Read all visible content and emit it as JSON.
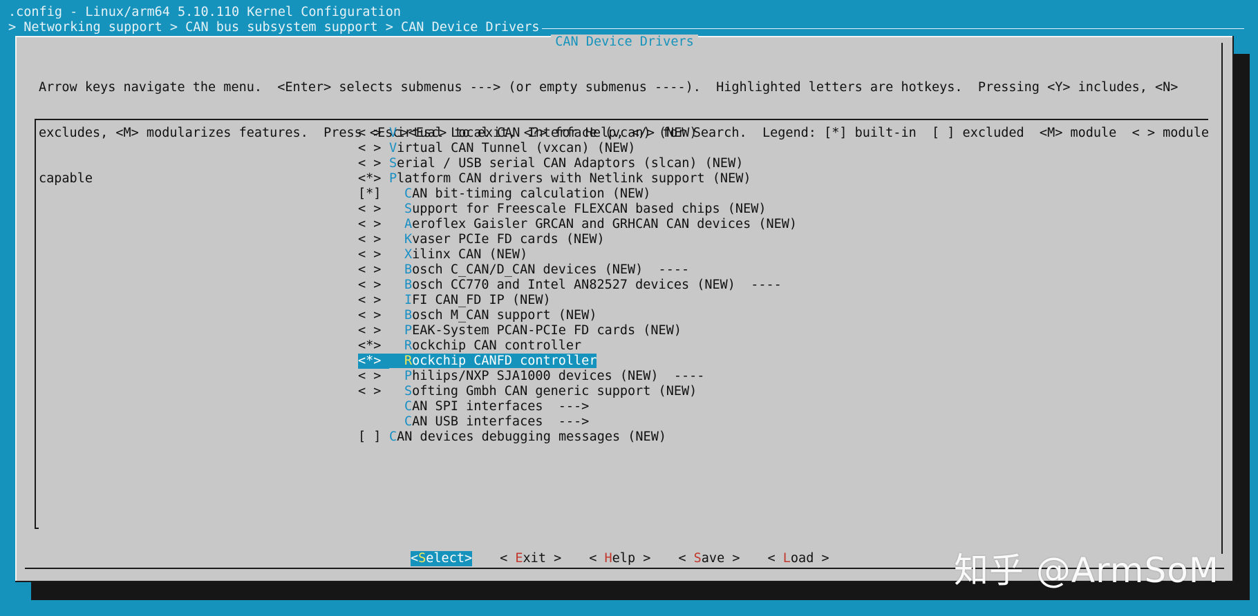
{
  "window_title": ".config - Linux/arm64 5.10.110 Kernel Configuration",
  "breadcrumb": "> Networking support > CAN bus subsystem support > CAN Device Drivers",
  "dialog_title": "CAN Device Drivers",
  "help": {
    "line1": "Arrow keys navigate the menu.  <Enter> selects submenus ---> (or empty submenus ----).  Highlighted letters are hotkeys.  Pressing <Y> includes, <N>",
    "line2": "excludes, <M> modularizes features.  Press <Esc><Esc> to exit, <?> for Help, </> for Search.  Legend: [*] built-in  [ ] excluded  <M> module  < > module",
    "line3": "capable"
  },
  "menu": [
    {
      "state": "< >",
      "indent": 0,
      "hot": "V",
      "rest": "irtual Local CAN Interface (vcan) (NEW)"
    },
    {
      "state": "< >",
      "indent": 0,
      "hot": "V",
      "rest": "irtual CAN Tunnel (vxcan) (NEW)"
    },
    {
      "state": "< >",
      "indent": 0,
      "hot": "S",
      "rest": "erial / USB serial CAN Adaptors (slcan) (NEW)"
    },
    {
      "state": "<*>",
      "indent": 0,
      "hot": "P",
      "rest": "latform CAN drivers with Netlink support (NEW)"
    },
    {
      "state": "[*]",
      "indent": 1,
      "hot": "C",
      "rest": "AN bit-timing calculation (NEW)"
    },
    {
      "state": "< >",
      "indent": 1,
      "hot": "S",
      "rest": "upport for Freescale FLEXCAN based chips (NEW)"
    },
    {
      "state": "< >",
      "indent": 1,
      "hot": "A",
      "rest": "eroflex Gaisler GRCAN and GRHCAN CAN devices (NEW)"
    },
    {
      "state": "< >",
      "indent": 1,
      "hot": "K",
      "rest": "vaser PCIe FD cards (NEW)"
    },
    {
      "state": "< >",
      "indent": 1,
      "hot": "X",
      "rest": "ilinx CAN (NEW)"
    },
    {
      "state": "< >",
      "indent": 1,
      "hot": "B",
      "rest": "osch C_CAN/D_CAN devices (NEW)  ----"
    },
    {
      "state": "< >",
      "indent": 1,
      "hot": "B",
      "rest": "osch CC770 and Intel AN82527 devices (NEW)  ----"
    },
    {
      "state": "< >",
      "indent": 1,
      "hot": "I",
      "rest": "FI CAN_FD IP (NEW)"
    },
    {
      "state": "< >",
      "indent": 1,
      "hot": "B",
      "rest": "osch M_CAN support (NEW)"
    },
    {
      "state": "< >",
      "indent": 1,
      "hot": "P",
      "rest": "EAK-System PCAN-PCIe FD cards (NEW)"
    },
    {
      "state": "<*>",
      "indent": 1,
      "hot": "R",
      "rest": "ockchip CAN controller"
    },
    {
      "state": "<*>",
      "indent": 1,
      "hot": "R",
      "rest": "ockchip CANFD controller",
      "selected": true
    },
    {
      "state": "< >",
      "indent": 1,
      "hot": "P",
      "rest": "hilips/NXP SJA1000 devices (NEW)  ----"
    },
    {
      "state": "< >",
      "indent": 1,
      "hot": "S",
      "rest": "ofting Gmbh CAN generic support (NEW)"
    },
    {
      "state": "   ",
      "indent": 1,
      "hot": "C",
      "rest": "AN SPI interfaces  --->"
    },
    {
      "state": "   ",
      "indent": 1,
      "hot": "C",
      "rest": "AN USB interfaces  --->"
    },
    {
      "state": "[ ]",
      "indent": 0,
      "hot": "C",
      "rest": "AN devices debugging messages (NEW)"
    }
  ],
  "buttons": [
    {
      "pre": "<",
      "hot": "S",
      "rest": "elect",
      "post": ">",
      "selected": true
    },
    {
      "pre": "< ",
      "hot": "E",
      "rest": "xit",
      "post": " >"
    },
    {
      "pre": "< ",
      "hot": "H",
      "rest": "elp",
      "post": " >"
    },
    {
      "pre": "< ",
      "hot": "S",
      "rest": "ave",
      "post": " >"
    },
    {
      "pre": "< ",
      "hot": "L",
      "rest": "oad",
      "post": " >"
    }
  ],
  "watermark": "知乎 @ArmSoM",
  "colors": {
    "background": "#1593bc",
    "dialog": "#c8c8c8",
    "hotkey": "#1a8fc4",
    "button_hotkey": "#c2362b",
    "highlight_hotkey": "#f3e85a"
  }
}
